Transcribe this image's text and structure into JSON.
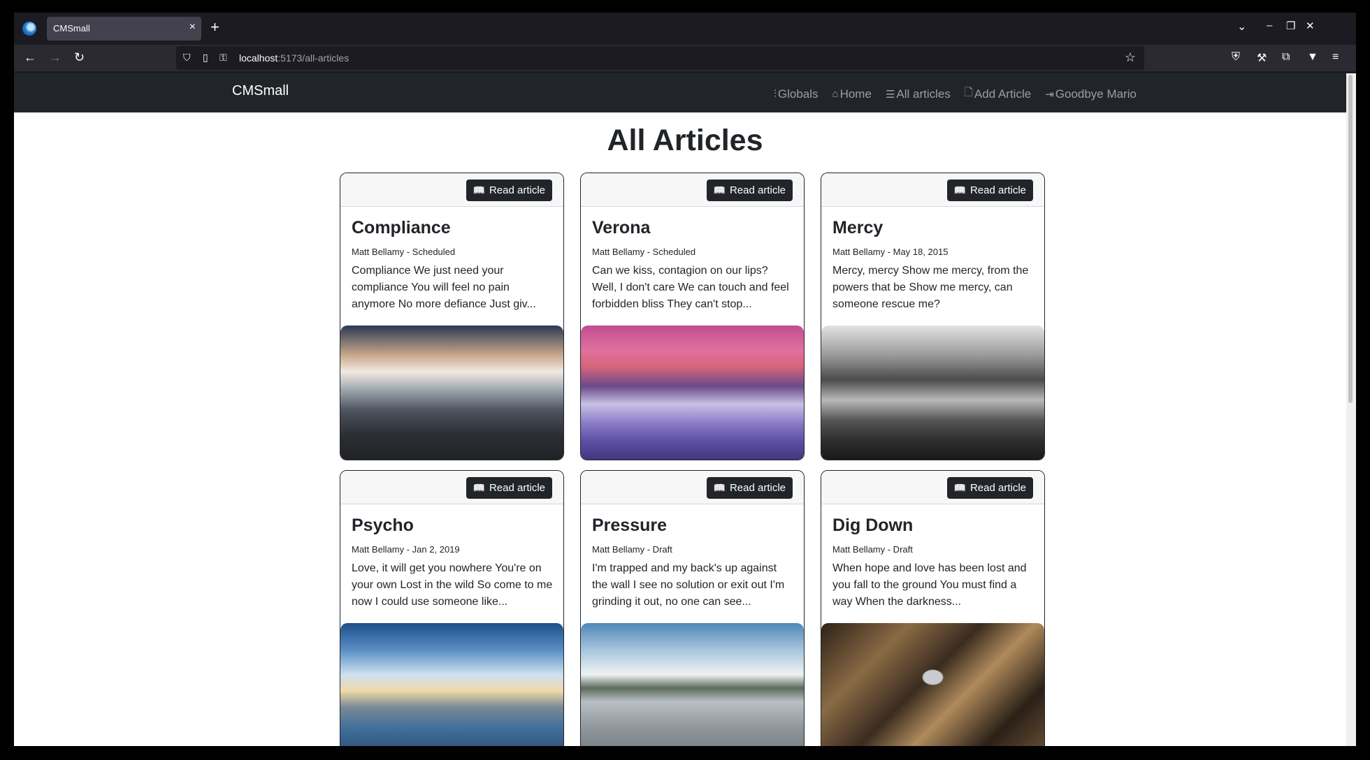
{
  "browser": {
    "tab_title": "CMSmall",
    "url_host": "localhost",
    "url_path": ":5173/all-articles"
  },
  "navbar": {
    "brand": "CMSmall",
    "links": [
      {
        "label": "Globals",
        "icon": "sliders-icon"
      },
      {
        "label": "Home",
        "icon": "home-icon"
      },
      {
        "label": "All articles",
        "icon": "list-icon"
      },
      {
        "label": "Add Article",
        "icon": "file-plus-icon"
      },
      {
        "label": "Goodbye Mario",
        "icon": "logout-icon"
      }
    ]
  },
  "page": {
    "title": "All Articles",
    "read_label": "Read article"
  },
  "articles": [
    {
      "title": "Compliance",
      "meta": "Matt Bellamy - Scheduled",
      "excerpt": "Compliance We just need your compliance You will feel no pain anymore No more defiance Just giv...",
      "image": "clouds-over-mountain-cliff"
    },
    {
      "title": "Verona",
      "meta": "Matt Bellamy - Scheduled",
      "excerpt": "Can we kiss, contagion on our lips? Well, I don't care We can touch and feel forbidden bliss They can't stop...",
      "image": "pink-snowy-mountain-peaks"
    },
    {
      "title": "Mercy",
      "meta": "Matt Bellamy - May 18, 2015",
      "excerpt": "Mercy, mercy Show me mercy, from the powers that be Show me mercy, can someone rescue me?",
      "image": "rocky-coast-black-white"
    },
    {
      "title": "Psycho",
      "meta": "Matt Bellamy - Jan 2, 2019",
      "excerpt": "Love, it will get you nowhere You're on your own Lost in the wild So come to me now I could use someone like...",
      "image": "geyser-river-blue-sky"
    },
    {
      "title": "Pressure",
      "meta": "Matt Bellamy - Draft",
      "excerpt": "I'm trapped and my back's up against the wall I see no solution or exit out I'm grinding it out, no one can see...",
      "image": "tower-in-calm-lake"
    },
    {
      "title": "Dig Down",
      "meta": "Matt Bellamy - Draft",
      "excerpt": "When hope and love has been lost and you fall to the ground You must find a way When the darkness...",
      "image": "winding-river-aerial"
    }
  ]
}
